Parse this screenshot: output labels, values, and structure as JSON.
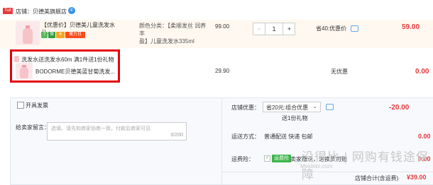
{
  "shop": {
    "tag": "Tuit",
    "label": "店铺：",
    "name": "贝德美旗舰店",
    "chat_icon": "chat-icon"
  },
  "item1": {
    "title": "【优惠价】贝德美儿童洗发水儿...",
    "badge7": "7",
    "badge_insure": "保",
    "badge_pay": "¥",
    "badge_juhuasuan": "聚力日",
    "spec_line1": "颜色分类：【柔顺发丝 润养丰",
    "spec_line2": "盈】儿童洗发水335ml",
    "price": "99.00",
    "qty_minus": "−",
    "qty_value": "1",
    "qty_plus": "+",
    "discount": "省40:优惠价",
    "subtotal": "59.00"
  },
  "item2": {
    "gift_header": "洗发水送洗发水60m   满1件送1份礼物",
    "title": "BODORME贝德美蓝甘菊洗发...",
    "price": "29.90",
    "discount": "无优惠",
    "subtotal": "0.00"
  },
  "left": {
    "invoice": "开具发票",
    "note_label": "给卖家留言：",
    "note_placeholder": "选填，请先和商家协商一致，付款后商家可见",
    "note_count": "0/200"
  },
  "right": {
    "shop_discount_label": "店铺优惠：",
    "shop_discount_value": "省20元:组合优惠",
    "shop_discount_amount": "-20.00",
    "gift_note": "送1份礼物",
    "shipping_label": "运送方式：",
    "shipping_value": "普通配送  快递  包邮",
    "shipping_amount": "0.00",
    "insurance_label": "运费险：",
    "insurance_badge": "运费险",
    "insurance_text": "卖家赠送，退换货可赔",
    "insurance_amount": "0.00",
    "total_label": "店铺合计(含运费)",
    "total_value": "¥39.00"
  },
  "watermark": {
    "text": "没得比 | 网购有钱途保障",
    "site": "Meidebi.com"
  },
  "colors": {
    "red": "#e4393c",
    "highlight": "#e3000b",
    "green": "#3bb54a",
    "blue": "#3a8ee6"
  }
}
